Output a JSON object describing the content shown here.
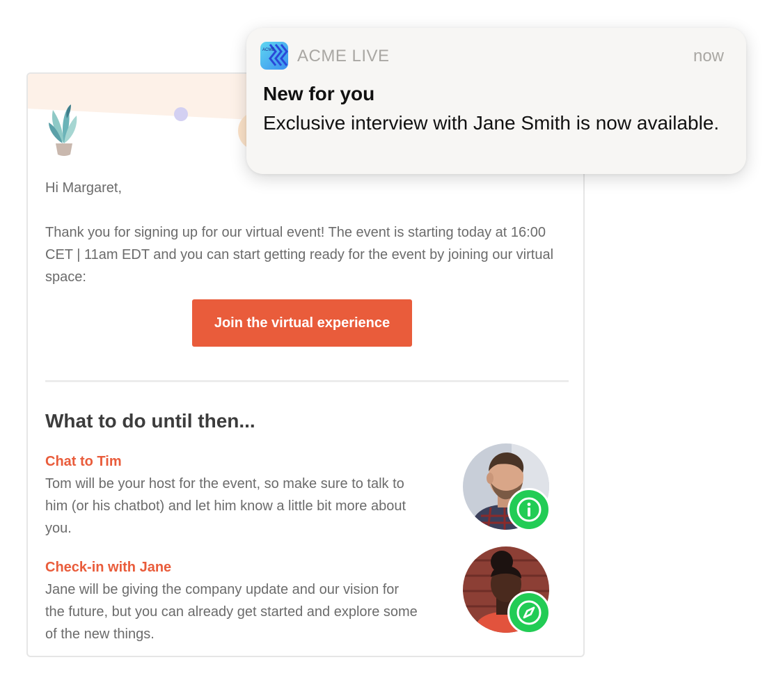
{
  "notification": {
    "app_name": "ACME LIVE",
    "app_icon_text": "ACME",
    "time": "now",
    "title": "New for you",
    "body": "Exclusive interview with Jane Smith is now available."
  },
  "email": {
    "greeting": "Hi Margaret,",
    "intro": "Thank you for signing up for our virtual event! The event is starting today at 16:00 CET | 11am EDT and you can start getting ready for the event by joining our virtual space:",
    "cta_label": "Join the virtual experience",
    "section_title": "What to do until then...",
    "items": [
      {
        "title": "Chat to Tim",
        "description": "Tom will be your host for the event, so make sure to talk to him (or his chatbot) and let him know a little bit more about you.",
        "badge_icon": "info-icon"
      },
      {
        "title": "Check-in with Jane",
        "description": "Jane will be giving the company update and our vision for the future, but you can already get started and explore some of the new things.",
        "badge_icon": "compass-icon"
      }
    ]
  },
  "colors": {
    "accent": "#e95c3b",
    "badge_green": "#22cc55",
    "body_text": "#6b6b6b",
    "heading_text": "#3c3c3c",
    "notification_bg": "#f7f6f4"
  }
}
